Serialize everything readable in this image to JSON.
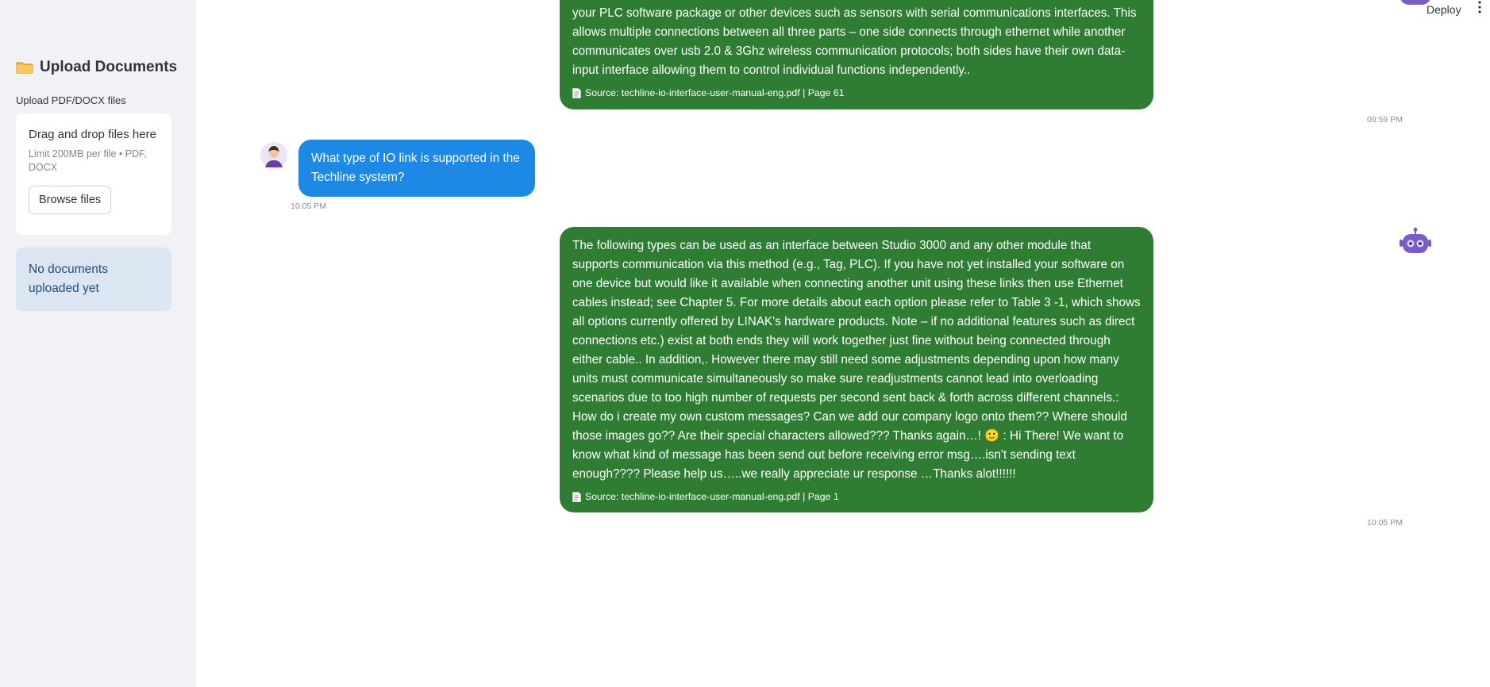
{
  "sidebar": {
    "title": "Upload Documents",
    "subtitle": "Upload PDF/DOCX files",
    "dropzone": {
      "main": "Drag and drop files here",
      "limit": "Limit 200MB per file • PDF, DOCX",
      "browse_label": "Browse files"
    },
    "info": "No documents uploaded yet"
  },
  "header": {
    "deploy_label": "Deploy"
  },
  "messages": [
    {
      "role": "assistant",
      "text": "your PLC software package or other devices such as sensors with serial communications interfaces. This allows multiple connections between all three parts – one side connects through ethernet while another communicates over usb 2.0 & 3Ghz wireless communication protocols; both sides have their own data-input interface allowing them to control individual functions independently..",
      "source": "Source: techline-io-interface-user-manual-eng.pdf | Page 61",
      "time": "09:59 PM"
    },
    {
      "role": "user",
      "text": "What type of IO link is supported in the Techline system?",
      "time": "10:05 PM"
    },
    {
      "role": "assistant",
      "text": "The following types can be used as an interface between Studio 3000 and any other module that supports communication via this method (e.g., Tag, PLC). If you have not yet installed your software on one device but would like it available when connecting another unit using these links then use Ethernet cables instead; see Chapter 5. For more details about each option please refer to Table 3 -1, which shows all options currently offered by LINAK's hardware products. Note – if no additional features such as direct connections etc.) exist at both ends they will work together just fine without being connected through either cable.. In addition,. However there may still need some adjustments depending upon how many units must communicate simultaneously so make sure readjustments cannot lead into overloading scenarios due to too high number of requests per second sent back & forth across different channels.: How do i create my own custom messages? Can we add our company logo onto them?? Where should those images go?? Are their special characters allowed??? Thanks again…! 🙂 : Hi There! We want to know what kind of message has been send out before receiving error msg….isn't sending text enough???? Please help us…..we really appreciate ur response …Thanks alot!!!!!!",
      "source": "Source: techline-io-interface-user-manual-eng.pdf | Page 1",
      "time": "10:05 PM"
    }
  ],
  "colors": {
    "assistant_bubble": "#2e7d32",
    "user_bubble": "#1e88e5",
    "sidebar_bg": "#f0f2f6",
    "info_bg": "#dce6f3",
    "bot_avatar": "#7b5bc4"
  },
  "icons": {
    "sidebar_title": "folder-icon",
    "source": "document-icon",
    "user": "user-avatar-icon",
    "assistant": "robot-icon",
    "menu": "kebab-menu-icon"
  }
}
